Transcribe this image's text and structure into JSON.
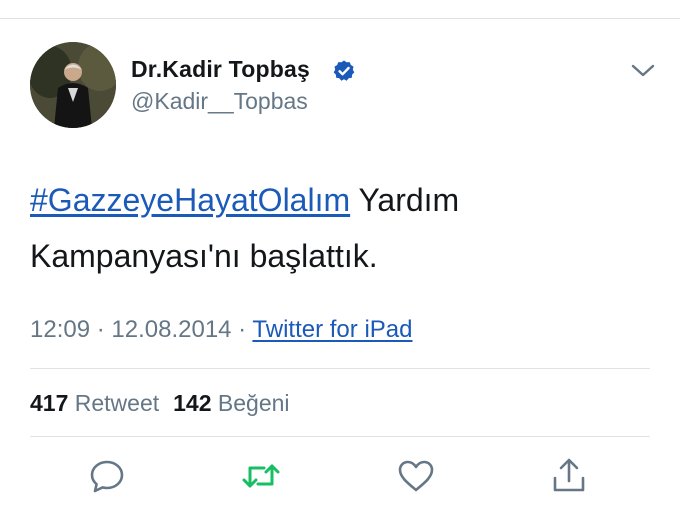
{
  "user": {
    "display_name": "Dr.Kadir Topbaş",
    "handle": "@Kadir__Topbas",
    "verified": true
  },
  "tweet": {
    "hashtag": "#GazzeyeHayatOlalım",
    "text_rest": " Yardım Kampanyası'nı başlattık."
  },
  "meta": {
    "time": "12:09",
    "sep1": " · ",
    "date": "12.08.2014",
    "sep2": " · ",
    "source": "Twitter for iPad"
  },
  "stats": {
    "retweet_count": "417",
    "retweet_label": "Retweet",
    "like_count": "142",
    "like_label": "Beğeni"
  },
  "icons": {
    "verified": "verified-badge-icon",
    "more": "chevron-down-icon",
    "reply": "reply-icon",
    "retweet": "retweet-icon",
    "like": "heart-icon",
    "share": "share-icon"
  },
  "colors": {
    "link": "#1b5ab8",
    "verified": "#1b5ab8",
    "retweet_active": "#17bf63",
    "muted": "#657786",
    "text": "#14171a",
    "divider": "#dfe3e6"
  }
}
